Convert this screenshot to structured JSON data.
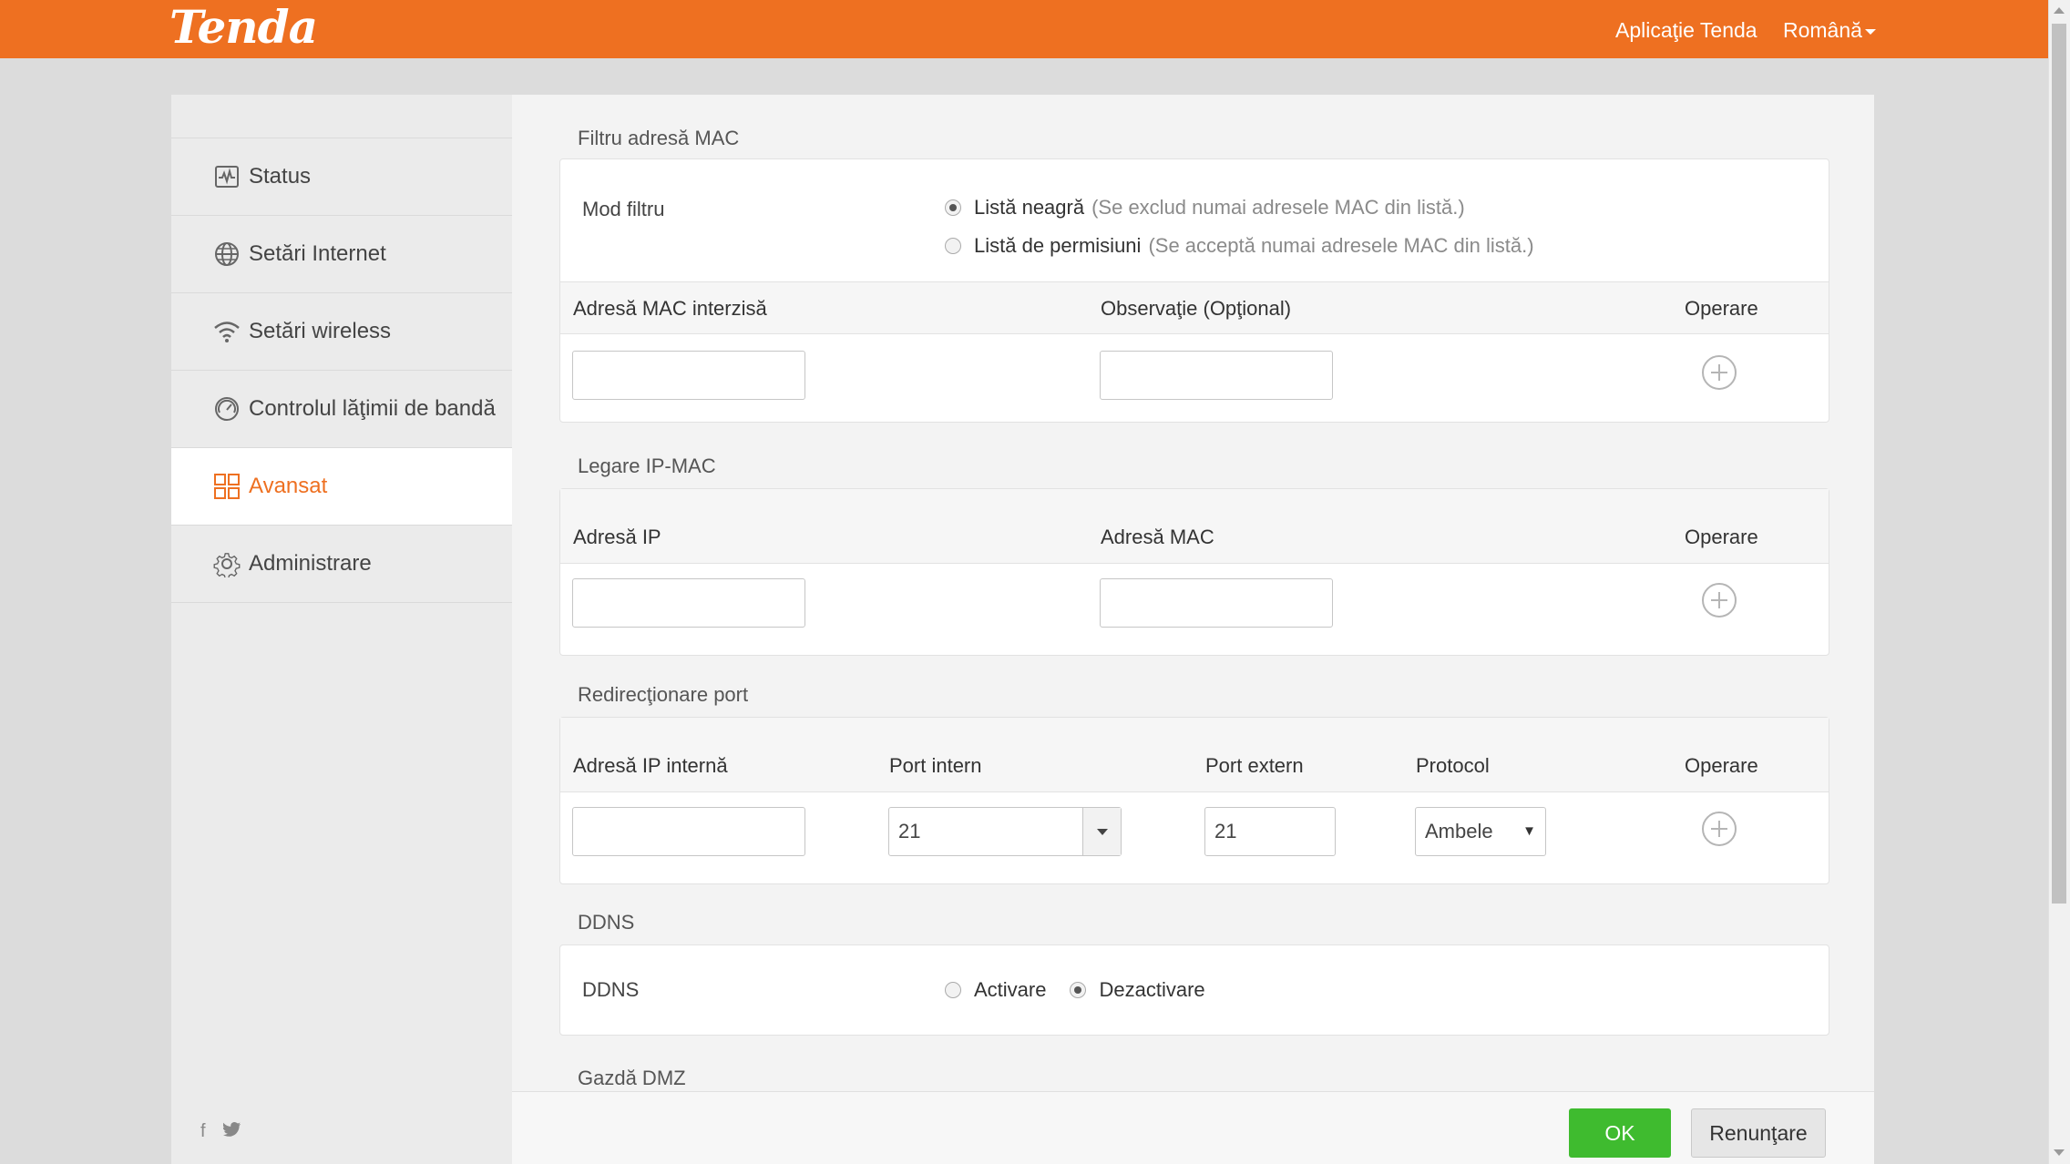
{
  "header": {
    "brand": "Tenda",
    "app_link": "Aplicaţie Tenda",
    "language": "Română"
  },
  "sidebar": {
    "items": [
      {
        "label": "Status",
        "icon": "status-icon",
        "active": false
      },
      {
        "label": "Setări Internet",
        "icon": "globe-icon",
        "active": false
      },
      {
        "label": "Setări wireless",
        "icon": "wifi-icon",
        "active": false
      },
      {
        "label": "Controlul lăţimii de bandă",
        "icon": "gauge-icon",
        "active": false
      },
      {
        "label": "Avansat",
        "icon": "grid-icon",
        "active": true
      },
      {
        "label": "Administrare",
        "icon": "gear-icon",
        "active": false
      }
    ],
    "social": [
      "f",
      "twitter"
    ]
  },
  "mac_filter": {
    "title": "Filtru adresă MAC",
    "mode_label": "Mod filtru",
    "blacklist_label": "Listă neagră",
    "blacklist_hint": "(Se exclud numai adresele MAC din listă.)",
    "whitelist_label": "Listă de permisiuni",
    "whitelist_hint": "(Se acceptă numai adresele MAC din listă.)",
    "selected": "blacklist",
    "columns": [
      "Adresă MAC interzisă",
      "Observaţie (Opţional)",
      "Operare"
    ],
    "mac_value": "",
    "note_value": ""
  },
  "ip_mac": {
    "title": "Legare IP-MAC",
    "columns": [
      "Adresă IP",
      "Adresă MAC",
      "Operare"
    ],
    "ip_value": "",
    "mac_value": ""
  },
  "port_fwd": {
    "title": "Redirecţionare port",
    "columns": [
      "Adresă IP internă",
      "Port intern",
      "Port extern",
      "Protocol",
      "Operare"
    ],
    "ip_value": "",
    "internal_port": "21",
    "external_port": "21",
    "protocol": "Ambele"
  },
  "ddns": {
    "title": "DDNS",
    "label": "DDNS",
    "enable_label": "Activare",
    "disable_label": "Dezactivare",
    "selected": "disable"
  },
  "dmz": {
    "title": "Gazdă DMZ"
  },
  "footer": {
    "ok_label": "OK",
    "cancel_label": "Renunţare"
  },
  "colors": {
    "accent": "#ee7021",
    "ok": "#3fbb2f"
  }
}
